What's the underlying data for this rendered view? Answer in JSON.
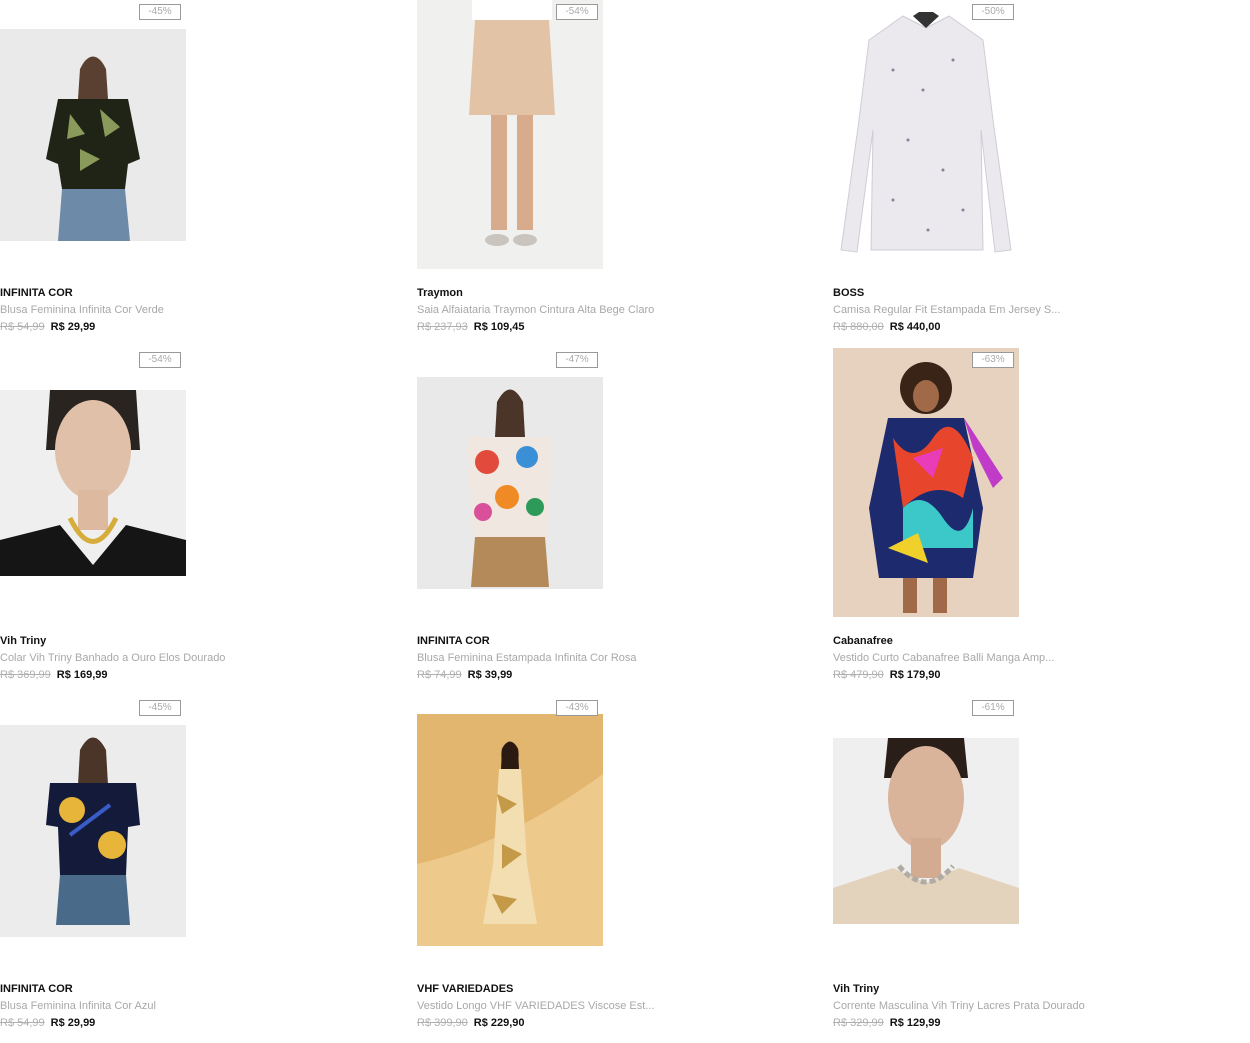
{
  "products": [
    {
      "discount": "-45%",
      "brand": "INFINITA COR",
      "name": "Blusa Feminina Infinita Cor Verde",
      "old_price": "R$ 54,99",
      "price": "R$ 29,99"
    },
    {
      "discount": "-54%",
      "brand": "Traymon",
      "name": "Saia Alfaiataria Traymon Cintura Alta Bege Claro",
      "old_price": "R$ 237,93",
      "price": "R$ 109,45"
    },
    {
      "discount": "-50%",
      "brand": "BOSS",
      "name": "Camisa Regular Fit Estampada Em Jersey S...",
      "old_price": "R$ 880,00",
      "price": "R$ 440,00"
    },
    {
      "discount": "-54%",
      "brand": "Vih Triny",
      "name": "Colar Vih Triny Banhado a Ouro Elos Dourado",
      "old_price": "R$ 369,99",
      "price": "R$ 169,99"
    },
    {
      "discount": "-47%",
      "brand": "INFINITA COR",
      "name": "Blusa Feminina Estampada Infinita Cor Rosa",
      "old_price": "R$ 74,99",
      "price": "R$ 39,99"
    },
    {
      "discount": "-63%",
      "brand": "Cabanafree",
      "name": "Vestido Curto Cabanafree Balli Manga Amp...",
      "old_price": "R$ 479,90",
      "price": "R$ 179,90"
    },
    {
      "discount": "-45%",
      "brand": "INFINITA COR",
      "name": "Blusa Feminina Infinita Cor Azul",
      "old_price": "R$ 54,99",
      "price": "R$ 29,99"
    },
    {
      "discount": "-43%",
      "brand": "VHF VARIEDADES",
      "name": "Vestido Longo VHF VARIEDADES Viscose Est...",
      "old_price": "R$ 399,90",
      "price": "R$ 229,90"
    },
    {
      "discount": "-61%",
      "brand": "Vih Triny",
      "name": "Corrente Masculina Vih Triny Lacres Prata Dourado",
      "old_price": "R$ 329,99",
      "price": "R$ 129,99"
    }
  ]
}
